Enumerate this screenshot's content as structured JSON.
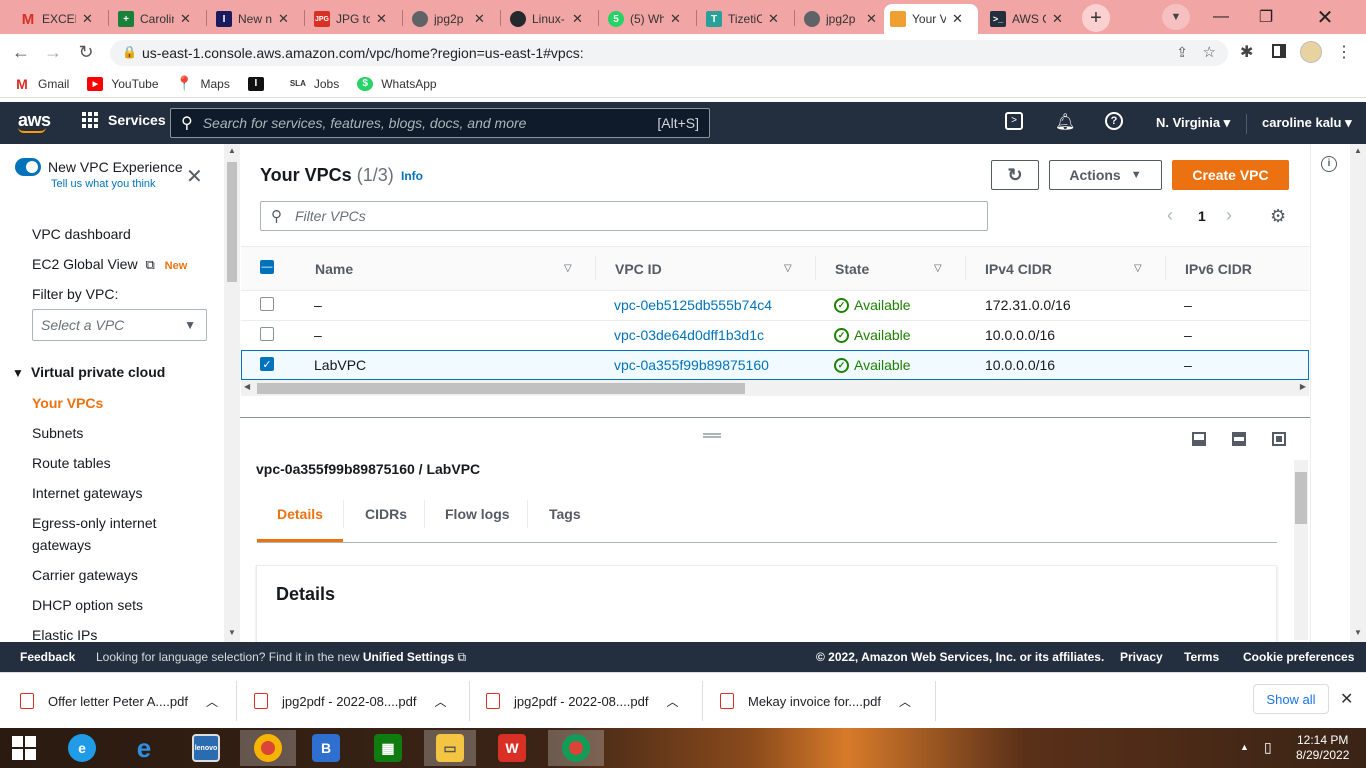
{
  "browser": {
    "tabs": [
      {
        "title": "EXCEL",
        "icon": "gmail-icon",
        "color": "#d93025"
      },
      {
        "title": "Carolin",
        "icon": "sheets-icon",
        "color": "#188038"
      },
      {
        "title": "New n",
        "icon": "indeed-icon",
        "color": "#1a1a5e"
      },
      {
        "title": "JPG to",
        "icon": "jpg-icon",
        "color": "#d93025"
      },
      {
        "title": "jpg2p",
        "icon": "globe-icon",
        "color": "#5f6368"
      },
      {
        "title": "Linux-",
        "icon": "github-icon",
        "color": "#24292e"
      },
      {
        "title": "(5) Wh",
        "icon": "whatsapp-icon",
        "color": "#25d366"
      },
      {
        "title": "TizetiC",
        "icon": "tizeti-icon",
        "color": "#2aa198"
      },
      {
        "title": "jpg2p",
        "icon": "globe-icon",
        "color": "#5f6368"
      },
      {
        "title": "Your V",
        "icon": "aws-cube-icon",
        "color": "#f0a030"
      },
      {
        "title": "AWS C",
        "icon": "terminal-icon",
        "color": "#232f3e"
      }
    ],
    "url": "us-east-1.console.aws.amazon.com/vpc/home?region=us-east-1#vpcs:",
    "bookmarks": [
      {
        "label": "Gmail",
        "icon": "gmail-icon",
        "color": "#d93025"
      },
      {
        "label": "YouTube",
        "icon": "youtube-icon",
        "color": "#ff0000"
      },
      {
        "label": "Maps",
        "icon": "maps-icon",
        "color": "#34a853"
      },
      {
        "label": "",
        "icon": "indeed-icon",
        "color": "#111"
      },
      {
        "label": "Jobs",
        "icon": "jobs-icon",
        "color": "#333"
      },
      {
        "label": "WhatsApp",
        "icon": "whatsapp-icon",
        "color": "#25d366"
      }
    ]
  },
  "aws_nav": {
    "logo": "aws",
    "services": "Services",
    "search_placeholder": "Search for services, features, blogs, docs, and more",
    "search_shortcut": "[Alt+S]",
    "region": "N. Virginia",
    "user": "caroline kalu"
  },
  "sidebar": {
    "experience_title": "New VPC Experience",
    "experience_sub": "Tell us what you think",
    "dashboard": "VPC dashboard",
    "ec2_global": "EC2 Global View",
    "new_badge": "New",
    "filter_label": "Filter by VPC:",
    "filter_placeholder": "Select a VPC",
    "section": "Virtual private cloud",
    "items": [
      "Your VPCs",
      "Subnets",
      "Route tables",
      "Internet gateways",
      "Egress-only internet",
      "gateways",
      "Carrier gateways",
      "DHCP option sets",
      "Elastic IPs"
    ]
  },
  "main": {
    "title": "Your VPCs",
    "count": "(1/3)",
    "info": "Info",
    "actions": "Actions",
    "create": "Create VPC",
    "filter_placeholder": "Filter VPCs",
    "page": "1",
    "columns": [
      "Name",
      "VPC ID",
      "State",
      "IPv4 CIDR",
      "IPv6 CIDR"
    ],
    "rows": [
      {
        "name": "–",
        "id": "vpc-0eb5125db555b74c4",
        "state": "Available",
        "cidr": "172.31.0.0/16",
        "ipv6": "–",
        "selected": false
      },
      {
        "name": "–",
        "id": "vpc-03de64d0dff1b3d1c",
        "state": "Available",
        "cidr": "10.0.0.0/16",
        "ipv6": "–",
        "selected": false
      },
      {
        "name": "LabVPC",
        "id": "vpc-0a355f99b89875160",
        "state": "Available",
        "cidr": "10.0.0.0/16",
        "ipv6": "–",
        "selected": true
      }
    ],
    "detail_title": "vpc-0a355f99b89875160 / LabVPC",
    "detail_tabs": [
      "Details",
      "CIDRs",
      "Flow logs",
      "Tags"
    ],
    "details_heading": "Details"
  },
  "footer": {
    "feedback": "Feedback",
    "lang_text": "Looking for language selection? Find it in the new",
    "unified": "Unified Settings",
    "copyright": "© 2022, Amazon Web Services, Inc. or its affiliates.",
    "privacy": "Privacy",
    "terms": "Terms",
    "cookies": "Cookie preferences"
  },
  "downloads": {
    "items": [
      "Offer letter Peter A....pdf",
      "jpg2pdf - 2022-08....pdf",
      "jpg2pdf - 2022-08....pdf",
      "Mekay invoice for....pdf"
    ],
    "show_all": "Show all"
  },
  "taskbar": {
    "time": "12:14 PM",
    "date": "8/29/2022"
  },
  "colors": {
    "aws_dark": "#232f3e",
    "aws_orange": "#ec7211",
    "link_blue": "#0073bb",
    "available_green": "#1d8102",
    "tabbar": "#f2a5a5"
  }
}
